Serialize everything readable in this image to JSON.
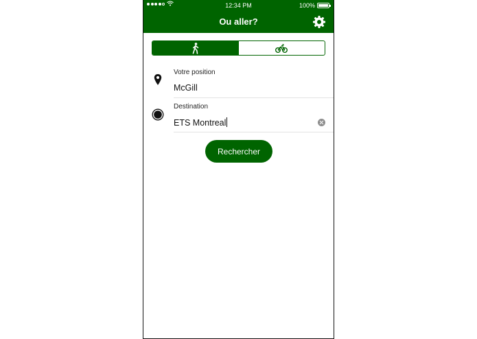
{
  "status_bar": {
    "time": "12:34 PM",
    "battery": "100%",
    "signal_bars_filled": 4,
    "signal_bars_total": 5,
    "icons": [
      "wifi-icon",
      "battery-icon"
    ]
  },
  "nav": {
    "title": "Ou aller?",
    "settings_icon": "gear-icon"
  },
  "mode_toggle": {
    "options": [
      {
        "icon": "walking-icon",
        "selected": true
      },
      {
        "icon": "bicycle-icon",
        "selected": false
      }
    ]
  },
  "origin": {
    "label": "Votre position",
    "value": "McGill",
    "icon": "map-pin-icon"
  },
  "destination": {
    "label": "Destination",
    "value": "ETS Montreal",
    "icon": "target-circle-icon",
    "clear_icon": "clear-icon"
  },
  "search_button": {
    "label": "Rechercher"
  },
  "colors": {
    "primary": "#006400",
    "background": "#ffffff",
    "divider": "#e3e3e3"
  }
}
